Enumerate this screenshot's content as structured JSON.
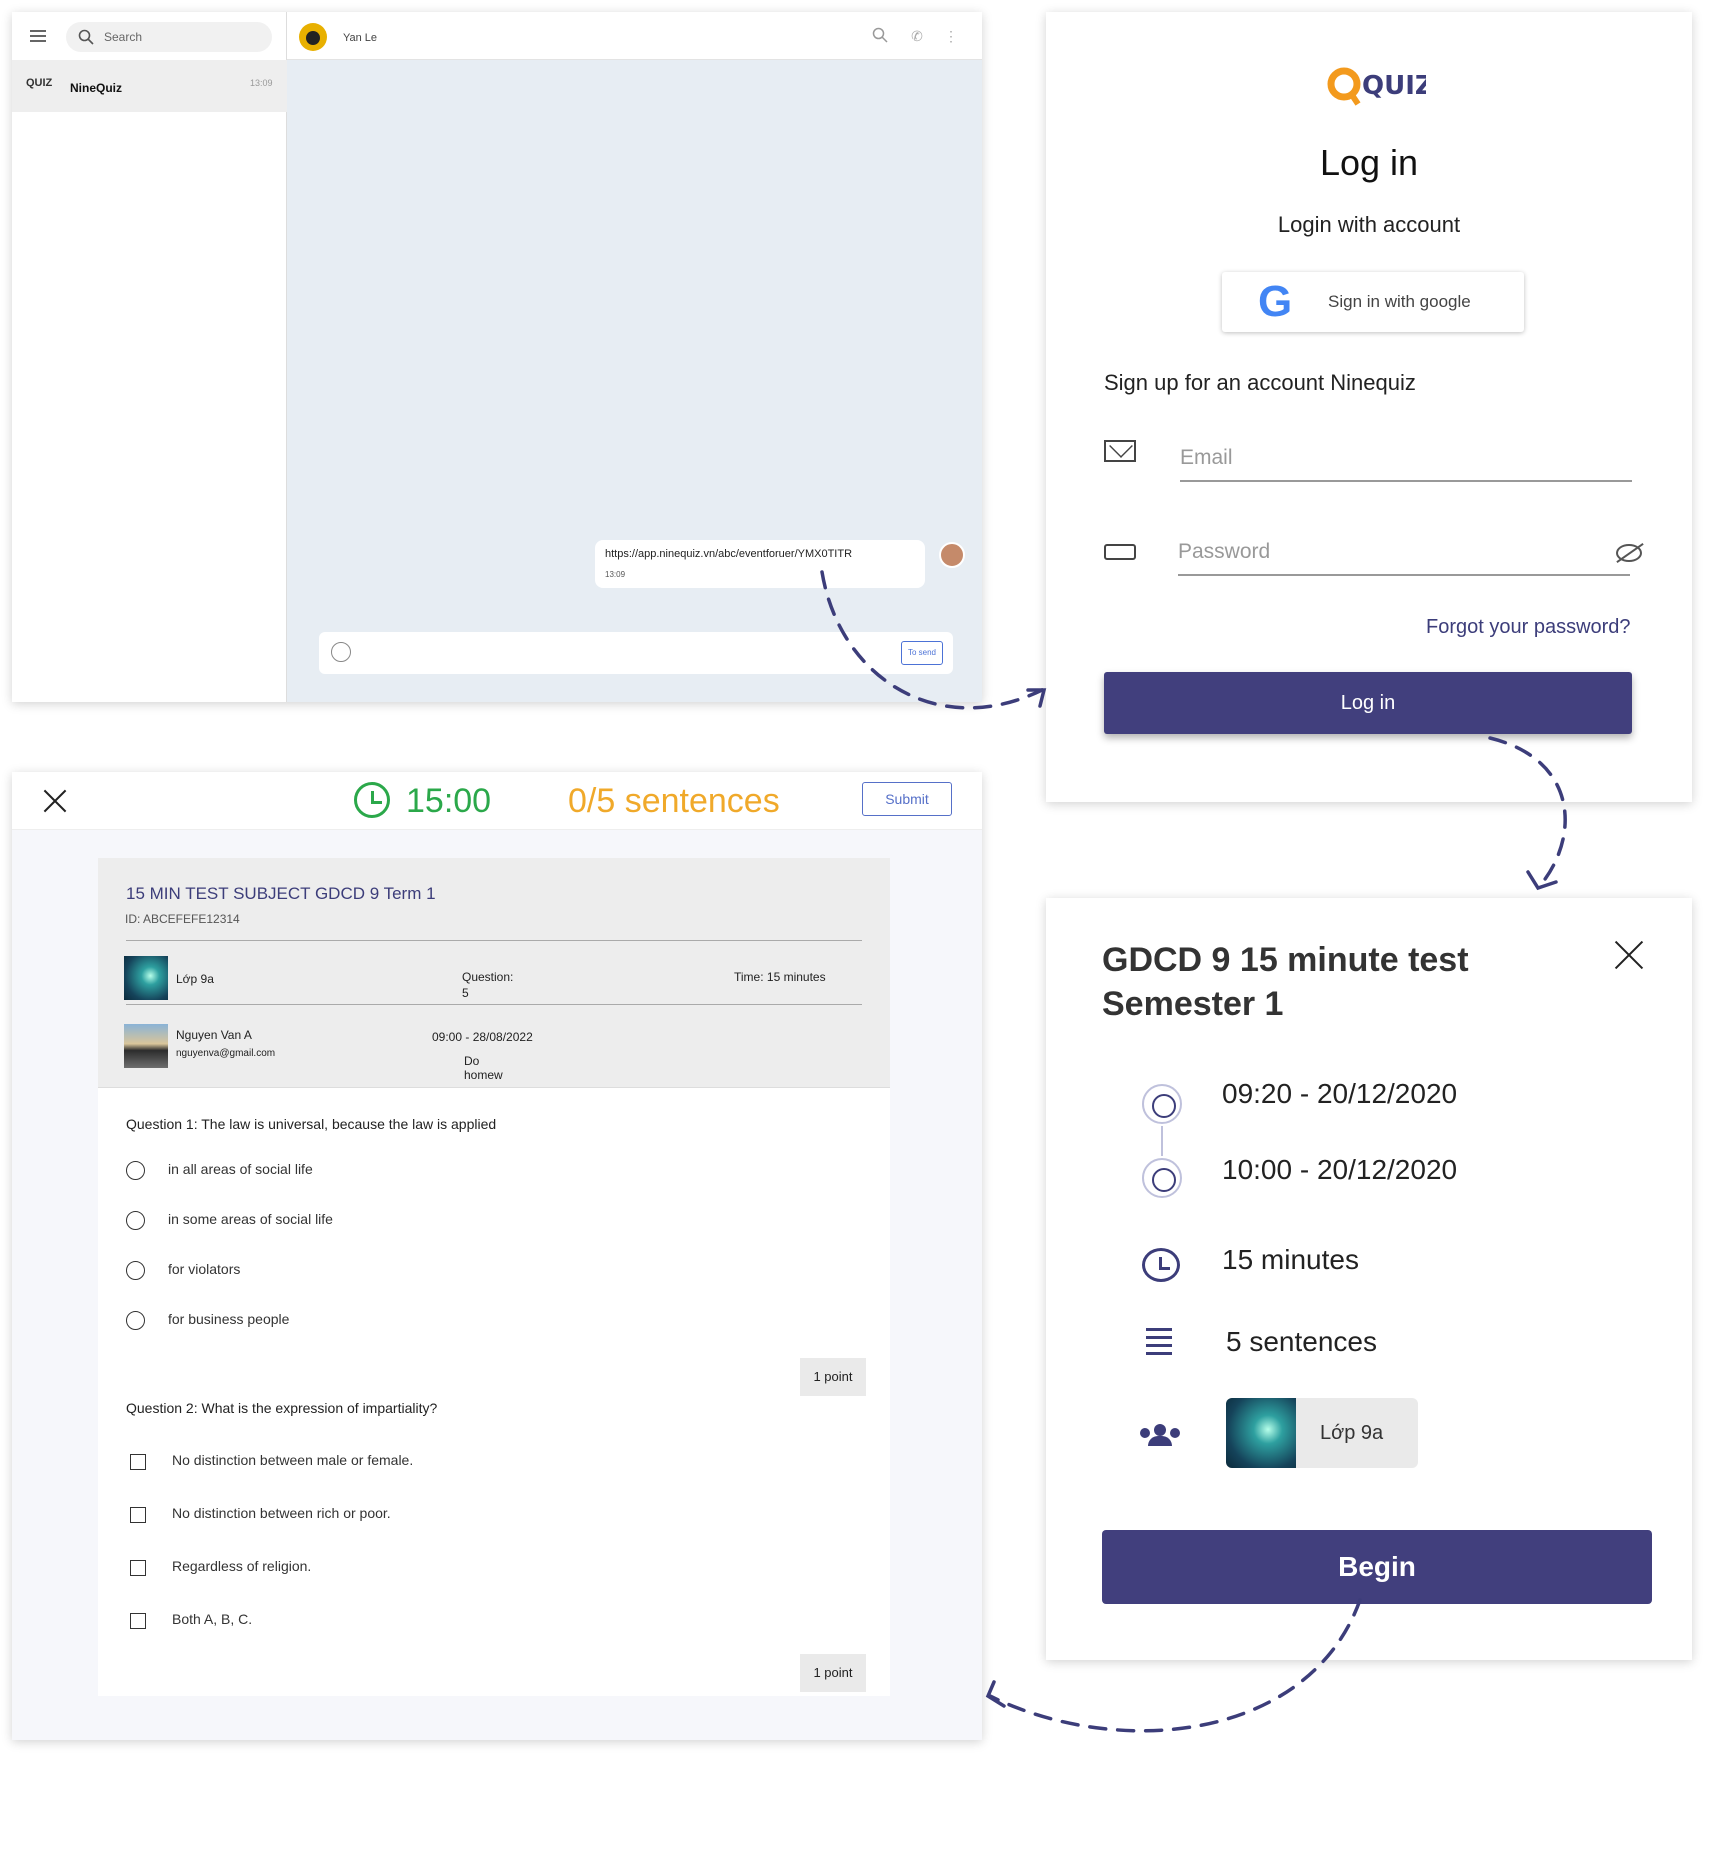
{
  "chat": {
    "search_placeholder": "Search",
    "conversation": {
      "logo": "QUIZ",
      "name": "NineQuiz",
      "time": "13:09"
    },
    "contact_name": "Yan Le",
    "message": {
      "link": "https://app.ninequiz.vn/abc/eventforuer/YMX0TITR",
      "time": "13:09"
    },
    "send_label": "To send"
  },
  "login": {
    "logo": "QUIZ",
    "title": "Log in",
    "subtitle": "Login with account",
    "google_label": "Sign in with google",
    "signup_text": "Sign up for an account Ninequiz",
    "email_placeholder": "Email",
    "password_placeholder": "Password",
    "forgot_label": "Forgot your password?",
    "login_button": "Log in"
  },
  "quiz": {
    "timer": "15:00",
    "progress": "0/5 sentences",
    "submit_label": "Submit",
    "title": "15 MIN TEST SUBJECT GDCD 9 Term 1",
    "id": "ID: ABCEFEFE12314",
    "class_name": "Lớp 9a",
    "question_label": "Question:",
    "question_count": "5",
    "time_label": "Time: 15 minutes",
    "author_name": "Nguyen Van A",
    "author_email": "nguyenva@gmail.com",
    "schedule": "09:00 - 28/08/2022",
    "task": "Do homew",
    "questions": [
      {
        "text": "Question 1: The law is universal, because the law is applied",
        "options": [
          "in all areas of social life",
          "in some areas of social life",
          "for violators",
          "for business people"
        ],
        "points": "1 point"
      },
      {
        "text": "Question 2: What is the expression of impartiality?",
        "options": [
          "No distinction between male or female.",
          "No distinction between rich or poor.",
          "Regardless of religion.",
          "Both A, B, C."
        ],
        "points": "1 point"
      }
    ]
  },
  "info": {
    "title": "GDCD 9 15 minute test Semester 1",
    "start": "09:20 - 20/12/2020",
    "end": "10:00 - 20/12/2020",
    "duration": "15 minutes",
    "sentences": "5 sentences",
    "class_name": "Lớp 9a",
    "begin_label": "Begin"
  },
  "colors": {
    "primary": "#413f7d",
    "timer": "#2ba84a",
    "progress": "#f0a92a",
    "link": "#5670c8"
  }
}
